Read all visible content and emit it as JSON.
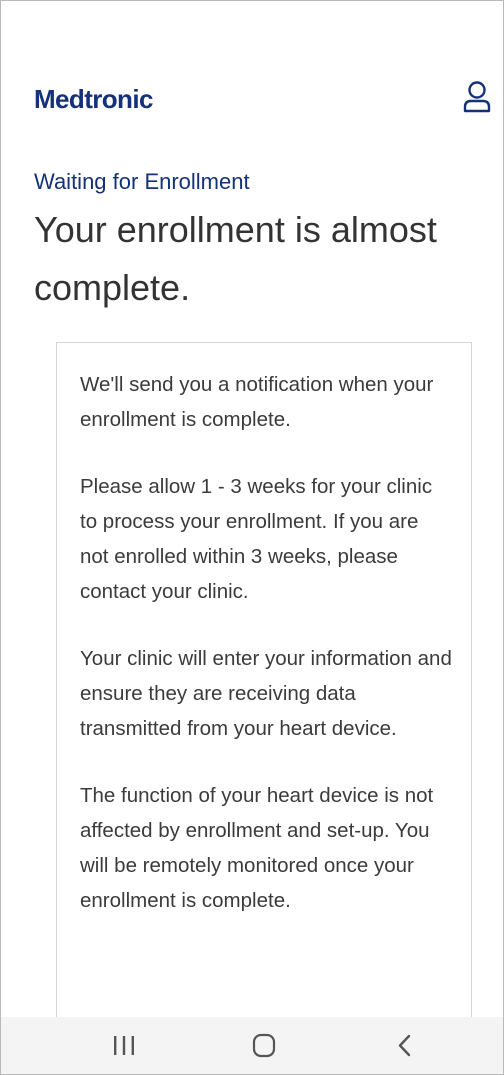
{
  "header": {
    "brand": "Medtronic",
    "profile_icon": "person-outline-icon"
  },
  "page": {
    "eyebrow": "Waiting for Enrollment",
    "title": "Your enrollment is almost complete."
  },
  "card": {
    "paragraphs": [
      "We'll send you a notification when your enrollment is complete.",
      "Please allow 1 - 3 weeks for your clinic to process your enrollment. If you are not enrolled within 3 weeks, please contact your clinic.",
      "Your clinic will enter your information and ensure they are receiving data transmitted from your heart device.",
      "The function of your heart device is not affected by enrollment and set-up. You will be remotely monitored once your enrollment is complete."
    ]
  },
  "navbar": {
    "recents_icon": "recent-apps-icon",
    "home_icon": "home-icon",
    "back_icon": "back-icon"
  },
  "colors": {
    "brand": "#14317a",
    "text": "#333333",
    "card_border": "#d5d5d5",
    "navbar_bg": "#f4f4f4"
  }
}
